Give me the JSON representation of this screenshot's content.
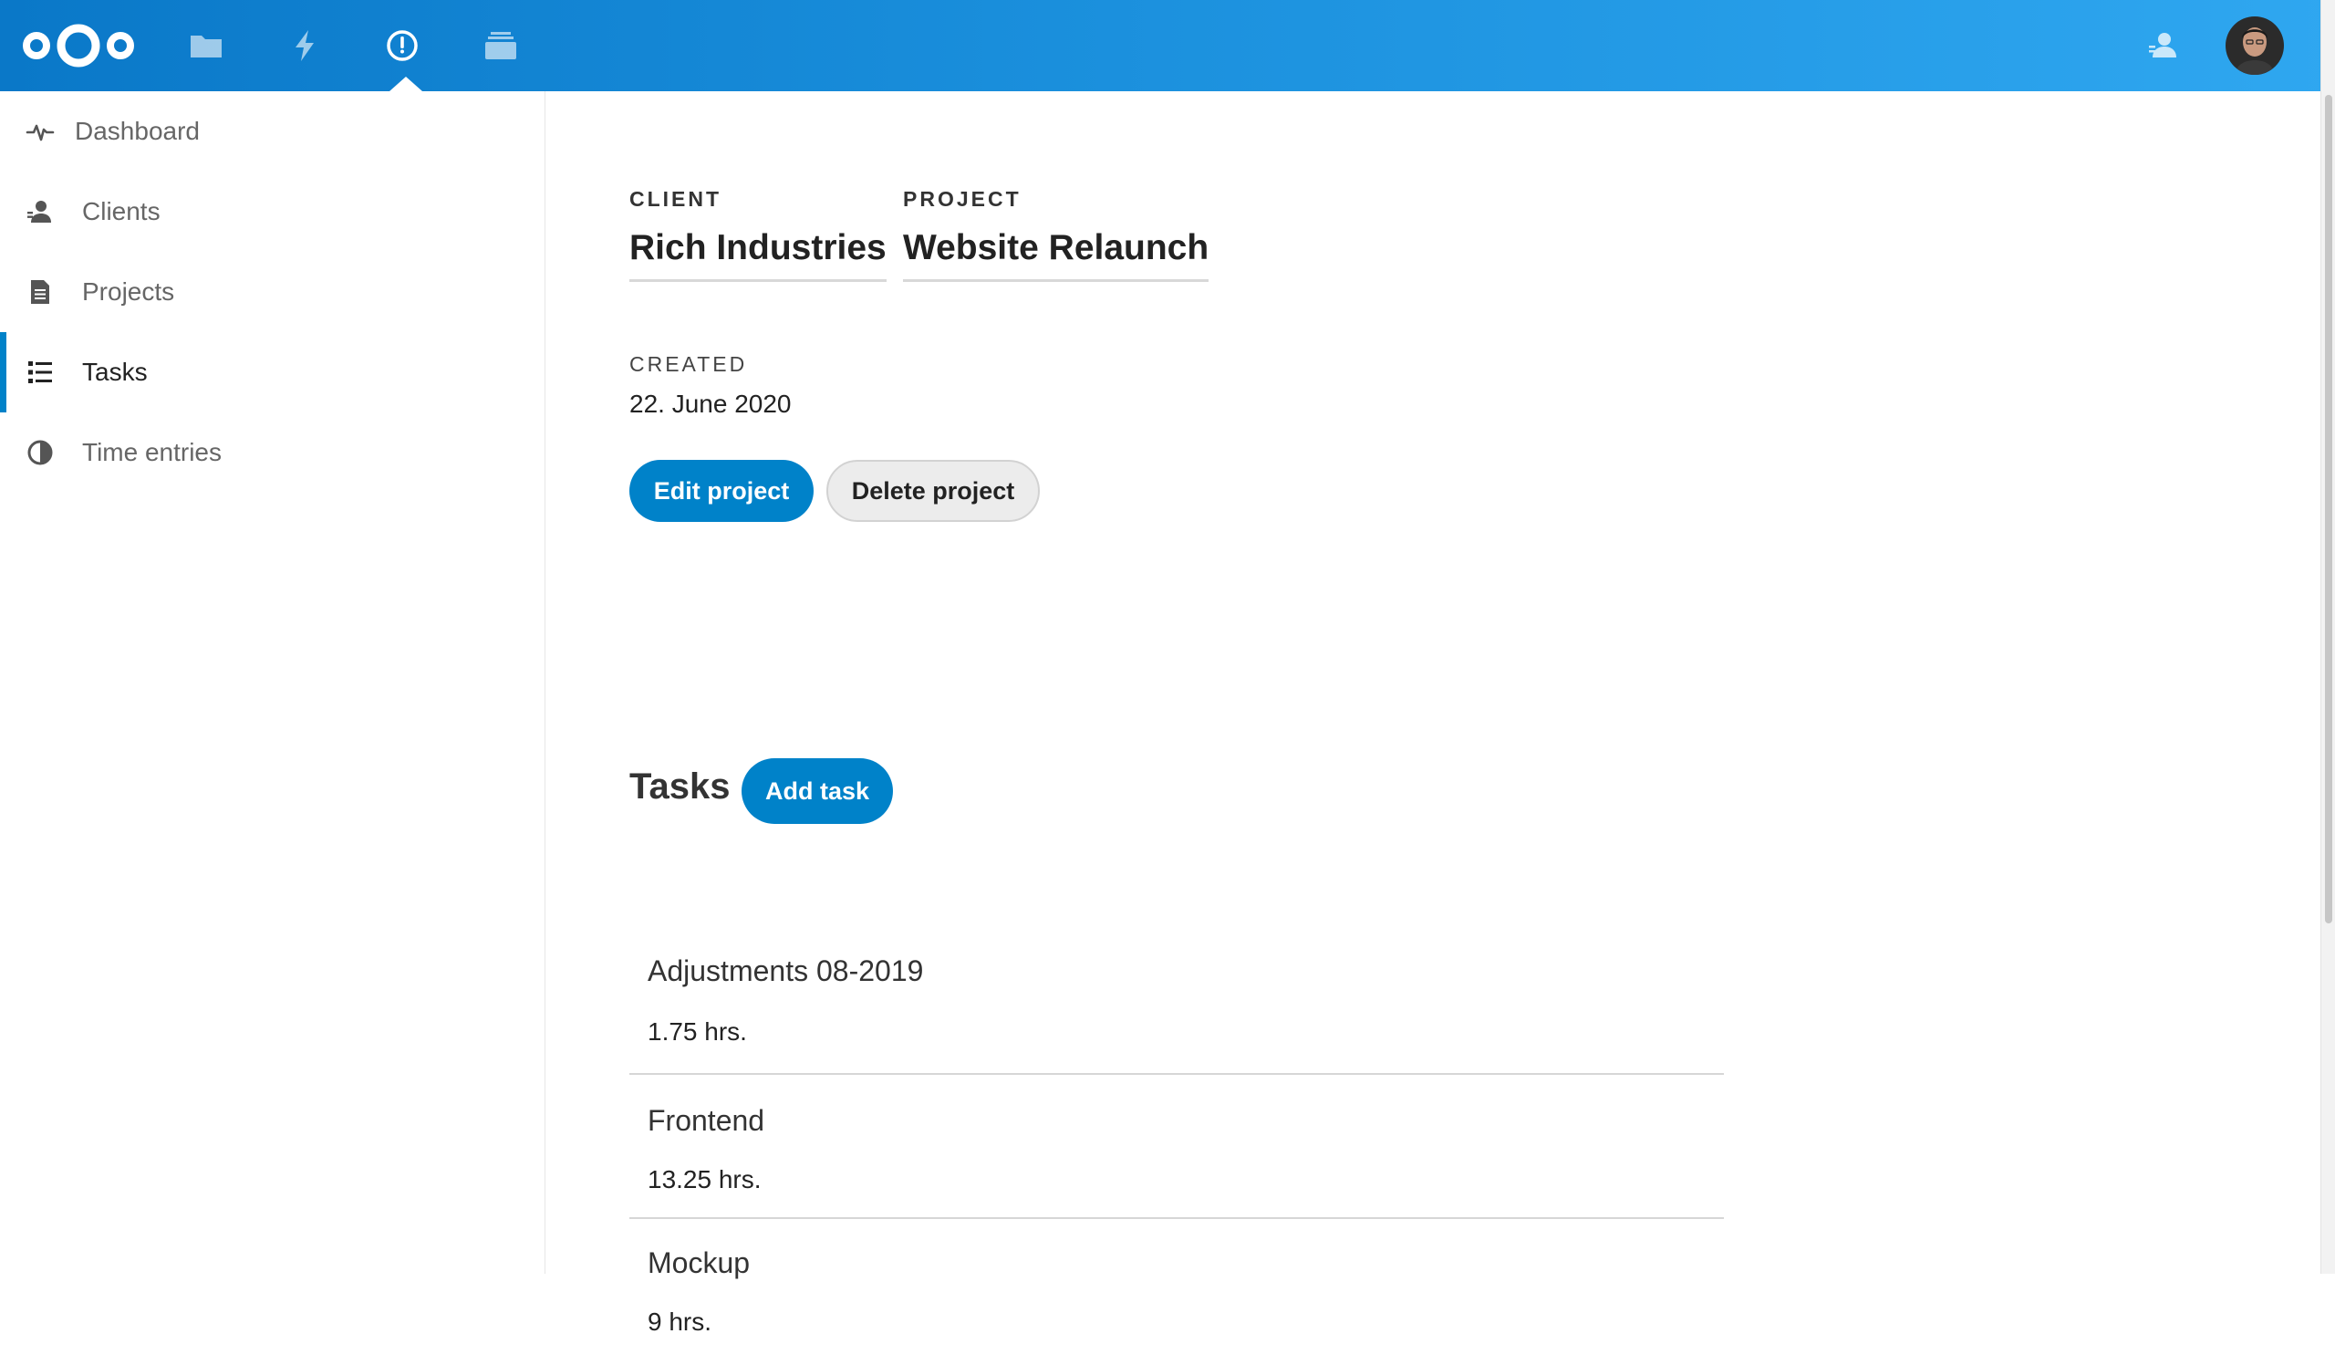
{
  "header": {
    "app_icons": [
      "files-icon",
      "activity-icon",
      "timemanager-icon",
      "deck-icon"
    ],
    "active_app": "timemanager-icon",
    "colors": {
      "gradient_start": "#0a78c8",
      "gradient_end": "#2fa7f0",
      "accent": "#0082c9"
    }
  },
  "sidebar": {
    "items": [
      {
        "label": "Dashboard",
        "icon": "pulse-icon"
      },
      {
        "label": "Clients",
        "icon": "contacts-icon"
      },
      {
        "label": "Projects",
        "icon": "document-icon"
      },
      {
        "label": "Tasks",
        "icon": "checklist-icon",
        "active": true
      },
      {
        "label": "Time entries",
        "icon": "pie-icon"
      }
    ]
  },
  "project": {
    "client_label": "CLIENT",
    "client_name": "Rich Industries",
    "project_label": "PROJECT",
    "project_name": "Website Relaunch",
    "created_label": "CREATED",
    "created_value": "22. June 2020",
    "edit_button": "Edit project",
    "delete_button": "Delete project"
  },
  "tasks": {
    "heading": "Tasks",
    "add_button": "Add task",
    "items": [
      {
        "name": "Adjustments 08-2019",
        "hours": "1.75 hrs."
      },
      {
        "name": "Frontend",
        "hours": "13.25 hrs."
      },
      {
        "name": "Mockup",
        "hours": "9 hrs."
      }
    ]
  }
}
